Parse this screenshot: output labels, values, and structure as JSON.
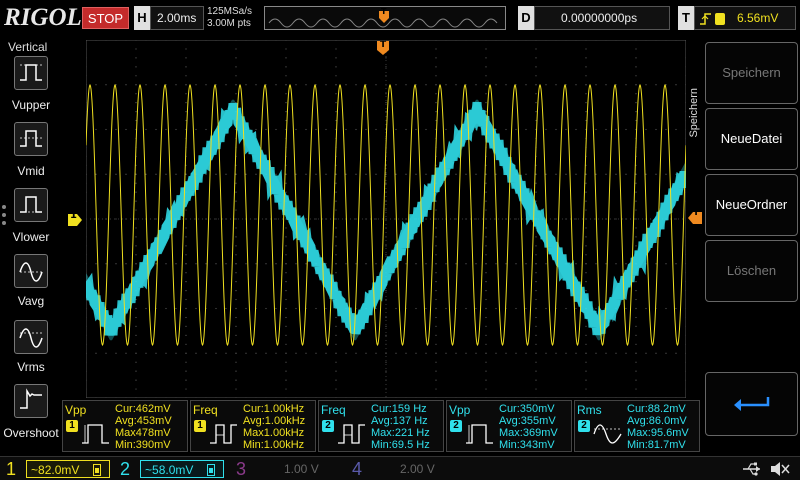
{
  "top": {
    "logo": "RIGOL",
    "run_state": "STOP",
    "h_key": "H",
    "timebase": "2.00ms",
    "sample_rate": "125MSa/s",
    "mem_depth": "3.00M pts",
    "trig_marker": "T",
    "d_key": "D",
    "delay": "0.00000000ps",
    "t_key": "T",
    "trig_level": "6.56mV"
  },
  "vertical": {
    "title": "Vertical",
    "buttons": [
      {
        "label": "Vupper",
        "icon": "vupper-icon"
      },
      {
        "label": "Vmid",
        "icon": "vmid-icon"
      },
      {
        "label": "Vlower",
        "icon": "vlower-icon"
      },
      {
        "label": "Vavg",
        "icon": "vavg-icon"
      },
      {
        "label": "Vrms",
        "icon": "vrms-icon"
      },
      {
        "label": "Overshoot",
        "icon": "overshoot-icon"
      }
    ]
  },
  "markers": {
    "ch1_left": "1",
    "trig_top": "T",
    "trig_right": "T"
  },
  "menu": {
    "title": "Speichern",
    "buttons": [
      {
        "label": "Speichern",
        "state": "disabled"
      },
      {
        "label": "NeueDatei",
        "state": "enabled"
      },
      {
        "label": "NeueOrdner",
        "state": "enabled"
      },
      {
        "label": "Löschen",
        "state": "disabled"
      }
    ],
    "return_icon": "return-arrow-icon"
  },
  "measurements": [
    {
      "name": "Vpp",
      "channel": "1",
      "cur": "Cur:462mV",
      "avg": "Avg:453mV",
      "max": "Max478mV",
      "min": "Min:390mV"
    },
    {
      "name": "Freq",
      "channel": "1",
      "cur": "Cur:1.00kHz",
      "avg": "Avg:1.00kHz",
      "max": "Max1.00kHz",
      "min": "Min:1.00kHz"
    },
    {
      "name": "Freq",
      "channel": "2",
      "cur": "Cur:159 Hz",
      "avg": "Avg:137 Hz",
      "max": "Max:221 Hz",
      "min": "Min:69.5 Hz"
    },
    {
      "name": "Vpp",
      "channel": "2",
      "cur": "Cur:350mV",
      "avg": "Avg:355mV",
      "max": "Max:369mV",
      "min": "Min:343mV"
    },
    {
      "name": "Rms",
      "channel": "2",
      "cur": "Cur:88.2mV",
      "avg": "Avg:86.0mV",
      "max": "Max:95.6mV",
      "min": "Min:81.7mV"
    }
  ],
  "channels": [
    {
      "num": "1",
      "scale": "82.0mV",
      "color": "#f0e020"
    },
    {
      "num": "2",
      "scale": "58.0mV",
      "color": "#30e0ec"
    },
    {
      "num": "3",
      "scale": "1.00 V",
      "color": "#8a3a8a"
    },
    {
      "num": "4",
      "scale": "2.00 V",
      "color": "#5a5aaa"
    }
  ],
  "colors": {
    "ch1": "#f0e020",
    "ch2": "#30e0ec",
    "trigger": "#f08a20",
    "stop": "#c42b2b"
  }
}
